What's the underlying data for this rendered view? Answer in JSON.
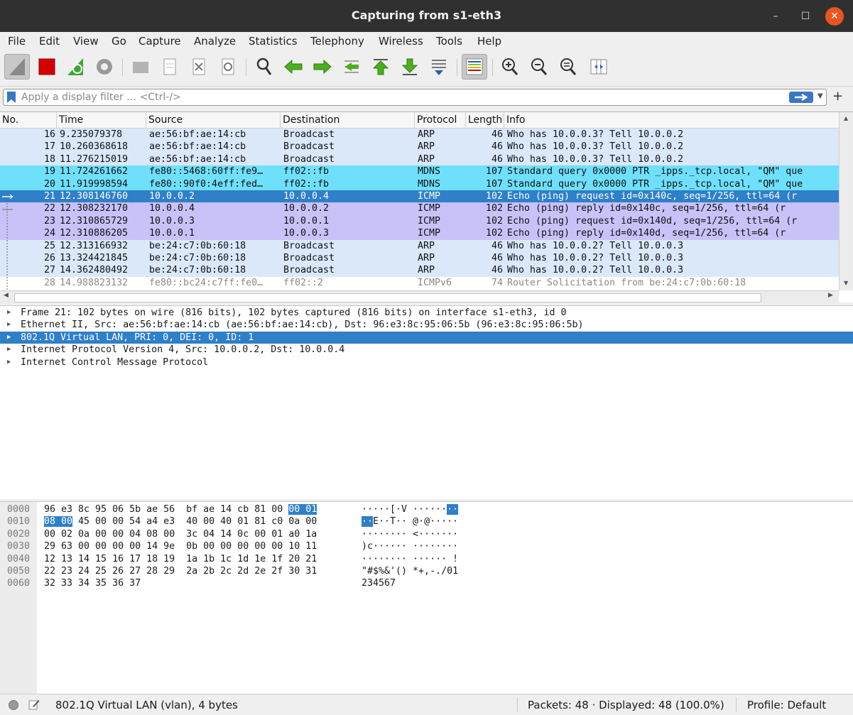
{
  "window": {
    "title": "Capturing from s1-eth3"
  },
  "menu": [
    "File",
    "Edit",
    "View",
    "Go",
    "Capture",
    "Analyze",
    "Statistics",
    "Telephony",
    "Wireless",
    "Tools",
    "Help"
  ],
  "toolbar": {
    "icons": [
      "shark-fin-start-icon",
      "stop-capture-icon",
      "restart-capture-icon",
      "capture-options-icon",
      "open-file-icon",
      "save-file-icon",
      "close-file-icon",
      "reload-file-icon",
      "find-packet-icon",
      "go-back-icon",
      "go-forward-icon",
      "go-to-packet-icon",
      "go-first-packet-icon",
      "go-last-packet-icon",
      "autoscroll-icon",
      "colorize-icon",
      "zoom-in-icon",
      "zoom-out-icon",
      "zoom-normal-icon",
      "resize-columns-icon"
    ]
  },
  "filter": {
    "placeholder": "Apply a display filter … <Ctrl-/>",
    "value": ""
  },
  "packet_list": {
    "columns": [
      "No.",
      "Time",
      "Source",
      "Destination",
      "Protocol",
      "Length",
      "Info"
    ],
    "rows": [
      {
        "no": "16",
        "time": "9.235079378",
        "src": "ae:56:bf:ae:14:cb",
        "dst": "Broadcast",
        "proto": "ARP",
        "len": "46",
        "info": "Who has 10.0.0.3? Tell 10.0.0.2",
        "color": "#dae8fa",
        "fg": "#111111"
      },
      {
        "no": "17",
        "time": "10.260368618",
        "src": "ae:56:bf:ae:14:cb",
        "dst": "Broadcast",
        "proto": "ARP",
        "len": "46",
        "info": "Who has 10.0.0.3? Tell 10.0.0.2",
        "color": "#dae8fa",
        "fg": "#111111"
      },
      {
        "no": "18",
        "time": "11.276215019",
        "src": "ae:56:bf:ae:14:cb",
        "dst": "Broadcast",
        "proto": "ARP",
        "len": "46",
        "info": "Who has 10.0.0.3? Tell 10.0.0.2",
        "color": "#dae8fa",
        "fg": "#111111"
      },
      {
        "no": "19",
        "time": "11.724261662",
        "src": "fe80::5468:60ff:fe9…",
        "dst": "ff02::fb",
        "proto": "MDNS",
        "len": "107",
        "info": "Standard query 0x0000 PTR _ipps._tcp.local, \"QM\" que",
        "color": "#6fe0fb",
        "fg": "#111111"
      },
      {
        "no": "20",
        "time": "11.919998594",
        "src": "fe80::90f0:4eff:fed…",
        "dst": "ff02::fb",
        "proto": "MDNS",
        "len": "107",
        "info": "Standard query 0x0000 PTR _ipps._tcp.local, \"QM\" que",
        "color": "#6fe0fb",
        "fg": "#111111"
      },
      {
        "no": "21",
        "time": "12.308146760",
        "src": "10.0.0.2",
        "dst": "10.0.0.4",
        "proto": "ICMP",
        "len": "102",
        "info": "Echo (ping) request  id=0x140c, seq=1/256, ttl=64 (r",
        "color": "#2f7fc9",
        "fg": "#ffffff"
      },
      {
        "no": "22",
        "time": "12.308232170",
        "src": "10.0.0.4",
        "dst": "10.0.0.2",
        "proto": "ICMP",
        "len": "102",
        "info": "Echo (ping) reply    id=0x140c, seq=1/256, ttl=64 (r",
        "color": "#c7c3f9",
        "fg": "#111111"
      },
      {
        "no": "23",
        "time": "12.310865729",
        "src": "10.0.0.3",
        "dst": "10.0.0.1",
        "proto": "ICMP",
        "len": "102",
        "info": "Echo (ping) request  id=0x140d, seq=1/256, ttl=64 (r",
        "color": "#c7c3f9",
        "fg": "#111111"
      },
      {
        "no": "24",
        "time": "12.310886205",
        "src": "10.0.0.1",
        "dst": "10.0.0.3",
        "proto": "ICMP",
        "len": "102",
        "info": "Echo (ping) reply    id=0x140d, seq=1/256, ttl=64 (r",
        "color": "#c7c3f9",
        "fg": "#111111"
      },
      {
        "no": "25",
        "time": "12.313166932",
        "src": "be:24:c7:0b:60:18",
        "dst": "Broadcast",
        "proto": "ARP",
        "len": "46",
        "info": "Who has 10.0.0.2? Tell 10.0.0.3",
        "color": "#dae8fa",
        "fg": "#111111"
      },
      {
        "no": "26",
        "time": "13.324421845",
        "src": "be:24:c7:0b:60:18",
        "dst": "Broadcast",
        "proto": "ARP",
        "len": "46",
        "info": "Who has 10.0.0.2? Tell 10.0.0.3",
        "color": "#dae8fa",
        "fg": "#111111"
      },
      {
        "no": "27",
        "time": "14.362480492",
        "src": "be:24:c7:0b:60:18",
        "dst": "Broadcast",
        "proto": "ARP",
        "len": "46",
        "info": "Who has 10.0.0.2? Tell 10.0.0.3",
        "color": "#dae8fa",
        "fg": "#111111"
      },
      {
        "no": "28",
        "time": "14.988823132",
        "src": "fe80::bc24:c7ff:fe0…",
        "dst": "ff02::2",
        "proto": "ICMPv6",
        "len": "74",
        "info": "Router Solicitation from be:24:c7:0b:60:18",
        "color": "#ffffff",
        "fg": "#8a8a8a"
      }
    ]
  },
  "details": {
    "rows": [
      {
        "text": "Frame 21: 102 bytes on wire (816 bits), 102 bytes captured (816 bits) on interface s1-eth3, id 0",
        "selected": false
      },
      {
        "text": "Ethernet II, Src: ae:56:bf:ae:14:cb (ae:56:bf:ae:14:cb), Dst: 96:e3:8c:95:06:5b (96:e3:8c:95:06:5b)",
        "selected": false
      },
      {
        "text": "802.1Q Virtual LAN, PRI: 0, DEI: 0, ID: 1",
        "selected": true
      },
      {
        "text": "Internet Protocol Version 4, Src: 10.0.0.2, Dst: 10.0.0.4",
        "selected": false
      },
      {
        "text": "Internet Control Message Protocol",
        "selected": false
      }
    ]
  },
  "bytes": {
    "rows": [
      {
        "offset": "0000",
        "hex": [
          [
            "96 e3 8c 95 06 5b ae 56  bf ae 14 cb 81 00 ",
            false
          ],
          [
            "00 01",
            true
          ]
        ],
        "ascii": [
          [
            "·····[·V ······",
            false
          ],
          [
            "··",
            true
          ]
        ]
      },
      {
        "offset": "0010",
        "hex": [
          [
            "08 00",
            true
          ],
          [
            " 45 00 00 54 a4 e3  40 00 40 01 81 c0 0a 00",
            false
          ]
        ],
        "ascii": [
          [
            "··",
            true
          ],
          [
            "E··T·· @·@·····",
            false
          ]
        ]
      },
      {
        "offset": "0020",
        "hex": [
          [
            "00 02 0a 00 00 04 08 00  3c 04 14 0c 00 01 a0 1a",
            false
          ]
        ],
        "ascii": [
          [
            "········ <·······",
            false
          ]
        ]
      },
      {
        "offset": "0030",
        "hex": [
          [
            "29 63 00 00 00 00 14 9e  0b 00 00 00 00 00 10 11",
            false
          ]
        ],
        "ascii": [
          [
            ")c······ ········",
            false
          ]
        ]
      },
      {
        "offset": "0040",
        "hex": [
          [
            "12 13 14 15 16 17 18 19  1a 1b 1c 1d 1e 1f 20 21",
            false
          ]
        ],
        "ascii": [
          [
            "········ ······ !",
            false
          ]
        ]
      },
      {
        "offset": "0050",
        "hex": [
          [
            "22 23 24 25 26 27 28 29  2a 2b 2c 2d 2e 2f 30 31",
            false
          ]
        ],
        "ascii": [
          [
            "\"#$%&'() *+,-./01",
            false
          ]
        ]
      },
      {
        "offset": "0060",
        "hex": [
          [
            "32 33 34 35 36 37",
            false
          ]
        ],
        "ascii": [
          [
            "234567",
            false
          ]
        ]
      }
    ]
  },
  "status": {
    "field": "802.1Q Virtual LAN (vlan), 4 bytes",
    "packets": "Packets: 48 · Displayed: 48 (100.0%)",
    "profile": "Profile: Default"
  }
}
